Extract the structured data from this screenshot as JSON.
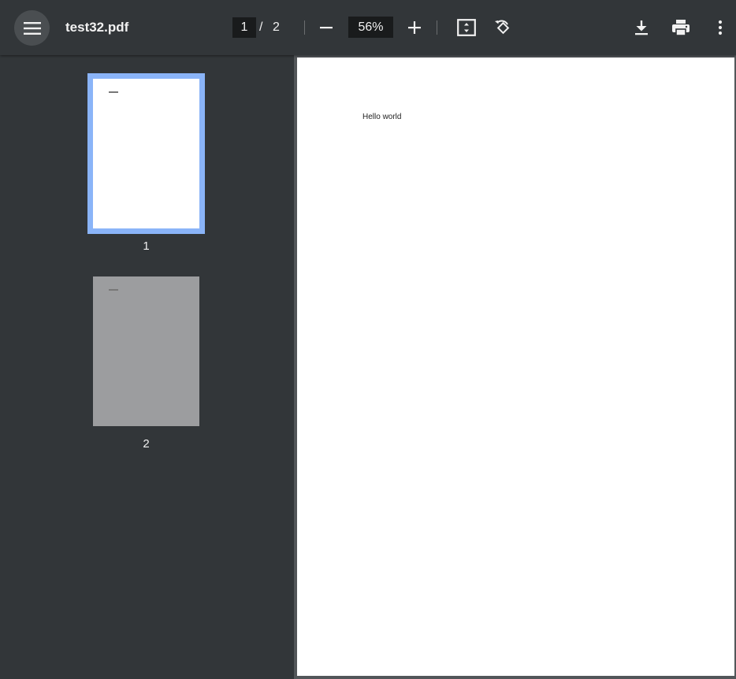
{
  "toolbar": {
    "menu_icon": "hamburger-menu-icon",
    "title": "test32.pdf",
    "current_page": "1",
    "page_separator": "/",
    "total_pages": "2",
    "zoom_level": "56%",
    "icons": {
      "zoom_out": "minus-icon",
      "zoom_in": "plus-icon",
      "fit": "fit-to-page-icon",
      "rotate": "rotate-counterclockwise-icon",
      "download": "download-icon",
      "print": "print-icon",
      "more": "more-vertical-icon"
    }
  },
  "sidebar": {
    "thumbnails": [
      {
        "label": "1",
        "selected": true
      },
      {
        "label": "2",
        "selected": false
      }
    ],
    "accent_color": "#8ab4f8"
  },
  "document": {
    "page_text": "Hello world"
  }
}
